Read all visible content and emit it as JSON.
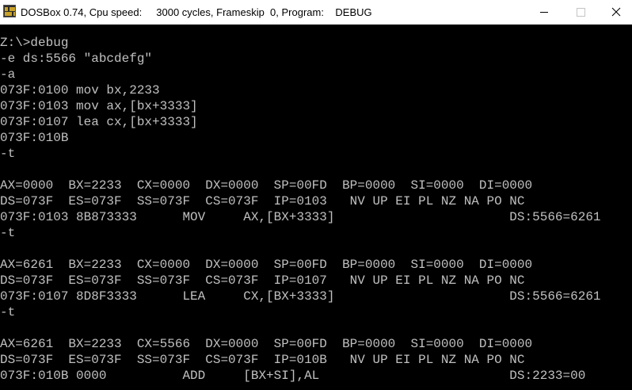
{
  "window": {
    "title": "DOSBox 0.74, Cpu speed:     3000 cycles, Frameskip  0, Program:    DEBUG"
  },
  "console": {
    "lines": [
      "Z:\\>debug",
      "-e ds:5566 \"abcdefg\"",
      "-a",
      "073F:0100 mov bx,2233",
      "073F:0103 mov ax,[bx+3333]",
      "073F:0107 lea cx,[bx+3333]",
      "073F:010B",
      "-t",
      "",
      "AX=0000  BX=2233  CX=0000  DX=0000  SP=00FD  BP=0000  SI=0000  DI=0000",
      "DS=073F  ES=073F  SS=073F  CS=073F  IP=0103   NV UP EI PL NZ NA PO NC",
      "073F:0103 8B873333      MOV     AX,[BX+3333]                       DS:5566=6261",
      "-t",
      "",
      "AX=6261  BX=2233  CX=0000  DX=0000  SP=00FD  BP=0000  SI=0000  DI=0000",
      "DS=073F  ES=073F  SS=073F  CS=073F  IP=0107   NV UP EI PL NZ NA PO NC",
      "073F:0107 8D8F3333      LEA     CX,[BX+3333]                       DS:5566=6261",
      "-t",
      "",
      "AX=6261  BX=2233  CX=5566  DX=0000  SP=00FD  BP=0000  SI=0000  DI=0000",
      "DS=073F  ES=073F  SS=073F  CS=073F  IP=010B   NV UP EI PL NZ NA PO NC",
      "073F:010B 0000          ADD     [BX+SI],AL                         DS:2233=00"
    ]
  },
  "colors": {
    "console_bg": "#000000",
    "console_text": "#c0c0c0",
    "titlebar_bg": "#ffffff"
  },
  "icons": {
    "app": "dosbox-icon",
    "minimize": "minimize-icon",
    "maximize": "maximize-icon",
    "close": "close-icon"
  }
}
